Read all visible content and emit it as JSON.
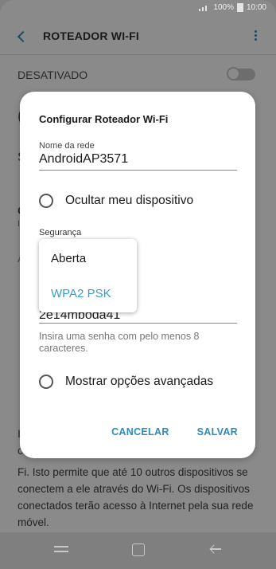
{
  "status": {
    "battery": "100%",
    "time": "10:00"
  },
  "appbar": {
    "title": "ROTEADOR WI-FI"
  },
  "toggle": {
    "label": "DESATIVADO"
  },
  "background_fragments": {
    "f1": "(",
    "f2": "S",
    "f3": "C",
    "f4": "I",
    "f5": "A",
    "f6": "I",
    "f7": "c"
  },
  "footer": {
    "text": "Fi. Isto permite que até 10 outros dispositivos se conectem a ele através do Wi-Fi. Os dispositivos conectados terão acesso à Internet pela sua rede móvel."
  },
  "dialog": {
    "title": "Configurar Roteador Wi-Fi",
    "network_name_label": "Nome da rede",
    "network_name_value": "AndroidAP3571",
    "hide_device_label": "Ocultar meu dispositivo",
    "security_label": "Segurança",
    "password_fragment": "2e14mboda41",
    "password_hint": "Insira uma senha com pelo menos 8 caracteres.",
    "advanced_label": "Mostrar opções avançadas",
    "cancel": "CANCELAR",
    "save": "SALVAR"
  },
  "dropdown": {
    "options": [
      "Aberta",
      "WPA2 PSK"
    ],
    "selected": "WPA2 PSK"
  },
  "colors": {
    "accent": "#2a8cc0",
    "underline": "#4a9bc1",
    "selected_option": "#3a9cc8"
  }
}
